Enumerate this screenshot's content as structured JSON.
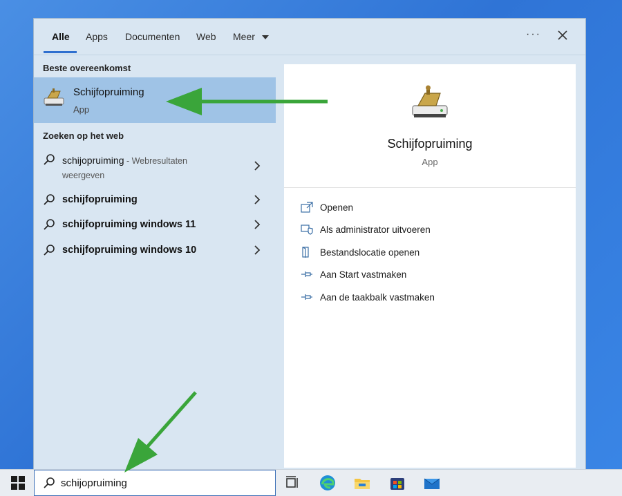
{
  "tabs": [
    {
      "label": "Alle",
      "active": true
    },
    {
      "label": "Apps"
    },
    {
      "label": "Documenten"
    },
    {
      "label": "Web"
    },
    {
      "label": "Meer"
    }
  ],
  "more_label": "···",
  "best_match": {
    "heading": "Beste overeenkomst",
    "title": "Schijfopruiming",
    "subtitle": "App"
  },
  "web": {
    "heading": "Zoeken op het web",
    "items": [
      {
        "text": "schijopruiming",
        "suffix": " - Webresultaten",
        "line2": "weergeven"
      },
      {
        "text": "schijfopruiming"
      },
      {
        "text": "schijfopruiming windows 11"
      },
      {
        "text": "schijfopruiming windows 10"
      }
    ]
  },
  "detail": {
    "title": "Schijfopruiming",
    "subtitle": "App",
    "actions": [
      {
        "label": "Openen",
        "icon": "open-icon"
      },
      {
        "label": "Als administrator uitvoeren",
        "icon": "shield-icon"
      },
      {
        "label": "Bestandslocatie openen",
        "icon": "file-location-icon"
      },
      {
        "label": "Aan Start vastmaken",
        "icon": "pin-icon"
      },
      {
        "label": "Aan de taakbalk vastmaken",
        "icon": "pin-icon"
      }
    ]
  },
  "search": {
    "value": "schijopruiming"
  },
  "colors": {
    "accent": "#2f6fcf",
    "selected": "#9fc3e6",
    "annotation_arrow": "#3aa53a"
  }
}
